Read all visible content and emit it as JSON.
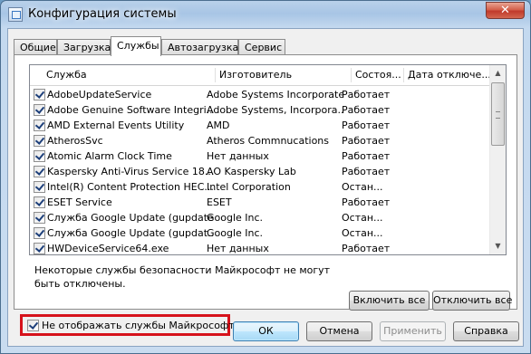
{
  "window": {
    "title": "Конфигурация системы",
    "close_glyph": "✕"
  },
  "tabs": [
    {
      "label": "Общие",
      "active": false
    },
    {
      "label": "Загрузка",
      "active": false
    },
    {
      "label": "Службы",
      "active": true
    },
    {
      "label": "Автозагрузка",
      "active": false
    },
    {
      "label": "Сервис",
      "active": false
    }
  ],
  "columns": {
    "service": "Служба",
    "manufacturer": "Изготовитель",
    "status": "Состоя...",
    "disabled_date": "Дата отключе..."
  },
  "services": [
    {
      "checked": true,
      "name": "AdobeUpdateService",
      "manufacturer": "Adobe Systems Incorporated",
      "status": "Работает"
    },
    {
      "checked": true,
      "name": "Adobe Genuine Software Integri...",
      "manufacturer": "Adobe Systems, Incorpora...",
      "status": "Работает"
    },
    {
      "checked": true,
      "name": "AMD External Events Utility",
      "manufacturer": "AMD",
      "status": "Работает"
    },
    {
      "checked": true,
      "name": "AtherosSvc",
      "manufacturer": "Atheros Commnucations",
      "status": "Работает"
    },
    {
      "checked": true,
      "name": "Atomic Alarm Clock Time",
      "manufacturer": "Нет данных",
      "status": "Работает"
    },
    {
      "checked": true,
      "name": "Kaspersky Anti-Virus Service 18....",
      "manufacturer": "AO Kaspersky Lab",
      "status": "Работает"
    },
    {
      "checked": true,
      "name": "Intel(R) Content Protection HEC...",
      "manufacturer": "Intel Corporation",
      "status": "Остан..."
    },
    {
      "checked": true,
      "name": "ESET Service",
      "manufacturer": "ESET",
      "status": "Работает"
    },
    {
      "checked": true,
      "name": "Служба Google Update (gupdate)",
      "manufacturer": "Google Inc.",
      "status": "Остан..."
    },
    {
      "checked": true,
      "name": "Служба Google Update (gupdat...",
      "manufacturer": "Google Inc.",
      "status": "Остан..."
    },
    {
      "checked": true,
      "name": "HWDeviceService64.exe",
      "manufacturer": "Нет данных",
      "status": "Работает"
    }
  ],
  "note": "Некоторые службы безопасности Майкрософт не могут быть отключены.",
  "buttons": {
    "enable_all": "Включить все",
    "disable_all": "Отключить все",
    "ok": "ОК",
    "cancel": "Отмена",
    "apply": "Применить",
    "help": "Справка"
  },
  "hide_microsoft": {
    "label": "Не отображать службы Майкрософт",
    "checked": true
  },
  "colors": {
    "highlight_border": "#d6121b"
  }
}
